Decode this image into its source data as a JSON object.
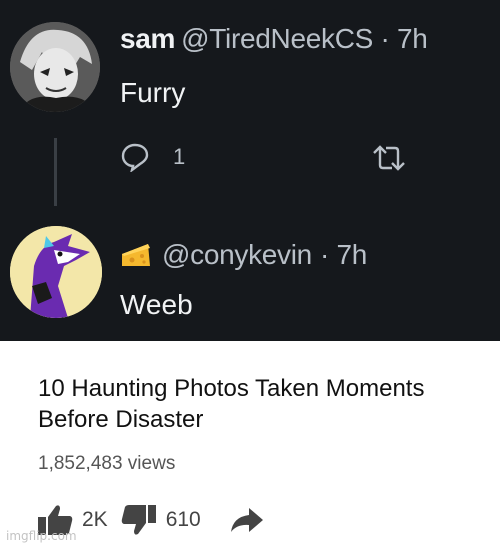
{
  "tweets": [
    {
      "display_name": "sam",
      "handle": "@TiredNeekCS",
      "time": "· 7h",
      "text": "Furry",
      "reply_count": "1"
    },
    {
      "display_name": "",
      "handle": "@conykevin",
      "time": "· 7h",
      "text": "Weeb"
    }
  ],
  "video": {
    "title": "10 Haunting Photos Taken Moments Before Disaster",
    "views": "1,852,483 views",
    "likes": "2K",
    "dislikes": "610"
  },
  "watermark": "imgflip.com",
  "icons": [
    "reply-icon",
    "retweet-icon",
    "cheese-emoji-icon",
    "thumbs-up-icon",
    "thumbs-down-icon",
    "share-icon"
  ],
  "colors": {
    "twitter_bg": "#15181c",
    "text": "#f1f3f5",
    "muted": "#b9c0c8"
  }
}
